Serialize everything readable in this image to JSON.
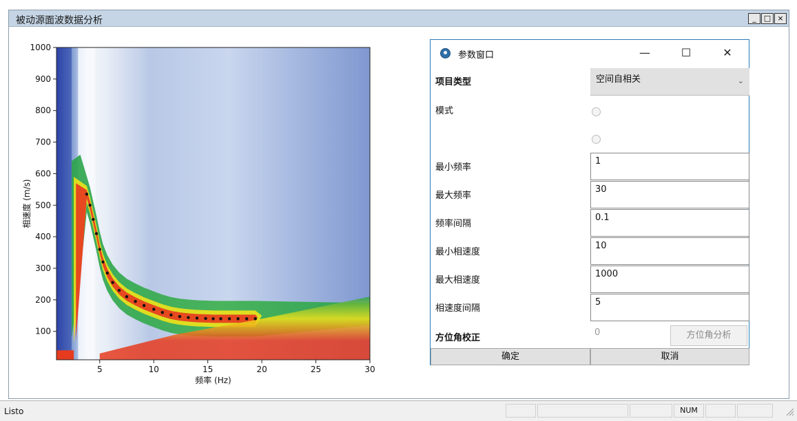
{
  "window": {
    "title": "被动源面波数据分析",
    "btn_minimize": "_",
    "btn_restore": "□",
    "btn_close": "×"
  },
  "chart_data": {
    "type": "heatmap",
    "xlabel": "频率 (Hz)",
    "ylabel": "相速度 (m/s)",
    "xlim": [
      1,
      30
    ],
    "ylim": [
      10,
      1000
    ],
    "x_ticks": [
      5,
      10,
      15,
      20,
      25,
      30
    ],
    "y_ticks": [
      100,
      200,
      300,
      400,
      500,
      600,
      700,
      800,
      900,
      1000
    ],
    "colormap": [
      "#1b2ea0",
      "#5a7dc8",
      "#bfd0ea",
      "#f3f6fb",
      "#2aa34a",
      "#f0e21b",
      "#e63b1f"
    ],
    "dispersion_picks": {
      "x": [
        3.8,
        4.1,
        4.4,
        4.7,
        5.0,
        5.3,
        5.7,
        6.2,
        6.8,
        7.5,
        8.3,
        9.1,
        10.0,
        10.8,
        11.6,
        12.4,
        13.2,
        14.0,
        14.8,
        15.5,
        16.2,
        17.0,
        17.8,
        18.6,
        19.4
      ],
      "y": [
        535,
        500,
        455,
        410,
        360,
        320,
        285,
        255,
        230,
        210,
        195,
        182,
        170,
        160,
        152,
        147,
        144,
        142,
        141,
        140,
        140,
        140,
        140,
        140,
        140
      ]
    }
  },
  "dialog": {
    "title": "参数窗口",
    "minimize_glyph": "—",
    "maximize_glyph": "☐",
    "close_glyph": "✕",
    "fields": {
      "type_label": "项目类型",
      "type_value": "空间自相关",
      "mode_label": "模式",
      "min_freq_label": "最小频率",
      "min_freq_value": "1",
      "max_freq_label": "最大频率",
      "max_freq_value": "30",
      "freq_step_label": "频率间隔",
      "freq_step_value": "0.1",
      "min_vel_label": "最小相速度",
      "min_vel_value": "10",
      "max_vel_label": "最大相速度",
      "max_vel_value": "1000",
      "vel_step_label": "相速度间隔",
      "vel_step_value": "5",
      "azimuth_label": "方位角校正",
      "azimuth_value": "0",
      "azimuth_button": "方位角分析"
    },
    "ok_button": "确定",
    "cancel_button": "取消"
  },
  "status": {
    "text": "Listo",
    "num": "NUM"
  }
}
